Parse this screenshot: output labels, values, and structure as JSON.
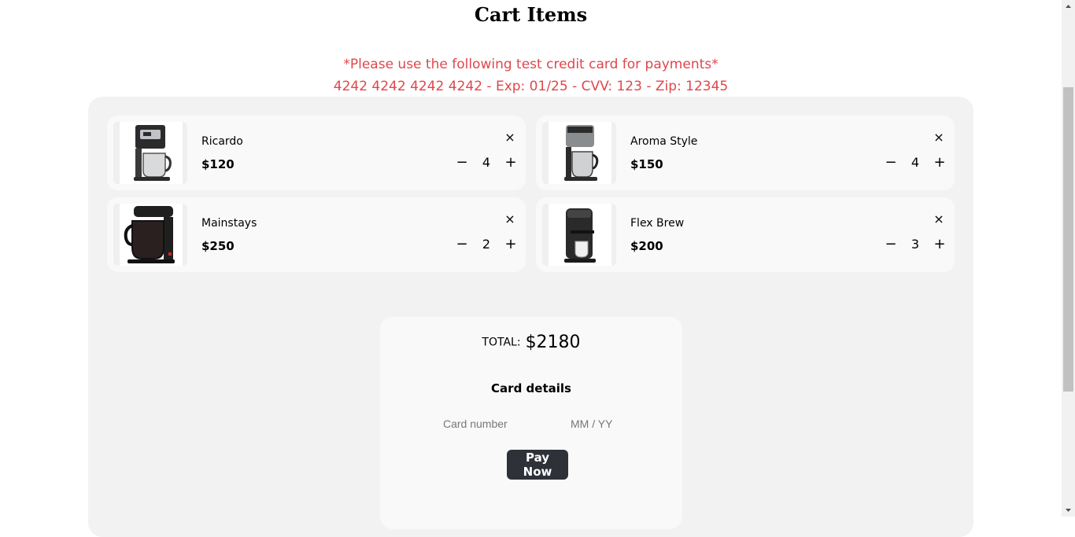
{
  "page": {
    "title": "Cart Items",
    "notice_line1": "*Please use the following test credit card for payments*",
    "notice_line2": "4242 4242 4242 4242 - Exp: 01/25 - CVV: 123 - Zip: 12345"
  },
  "cart": {
    "items": [
      {
        "name": "Ricardo",
        "price": "$120",
        "quantity": "4",
        "image": "coffee-maker-stainless-icon",
        "remove": "×",
        "minus": "−",
        "plus": "+"
      },
      {
        "name": "Aroma Style",
        "price": "$150",
        "quantity": "4",
        "image": "coffee-maker-silver-icon",
        "remove": "×",
        "minus": "−",
        "plus": "+"
      },
      {
        "name": "Mainstays",
        "price": "$250",
        "quantity": "2",
        "image": "coffee-maker-black-icon",
        "remove": "×",
        "minus": "−",
        "plus": "+"
      },
      {
        "name": "Flex Brew",
        "price": "$200",
        "quantity": "3",
        "image": "single-serve-brewer-icon",
        "remove": "×",
        "minus": "−",
        "plus": "+"
      }
    ]
  },
  "checkout": {
    "total_label": "TOTAL:",
    "total_value": "$2180",
    "card_title": "Card details",
    "card_number_placeholder": "Card number",
    "expiry_placeholder": "MM / YY",
    "pay_label": "Pay Now"
  },
  "colors": {
    "notice": "#e0464b",
    "panel": "#f2f2f2",
    "card": "#f9f9f9",
    "pay_button": "#2e3138"
  }
}
